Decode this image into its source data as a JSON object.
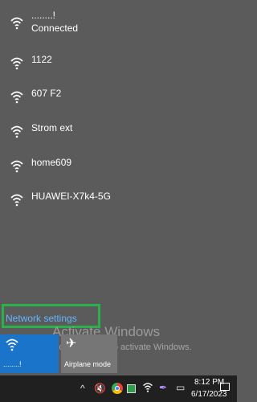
{
  "networks": [
    {
      "name": "........!",
      "status": "Connected",
      "icon": "wifi-icon"
    },
    {
      "name": "1122",
      "icon": "wifi-icon"
    },
    {
      "name": "607 F2",
      "icon": "wifi-icon"
    },
    {
      "name": "Strom ext",
      "icon": "wifi-icon"
    },
    {
      "name": "home609",
      "icon": "wifi-icon"
    },
    {
      "name": "HUAWEI-X7k4-5G",
      "icon": "wifi-icon"
    }
  ],
  "network_settings_label": "Network settings",
  "watermark": {
    "title": "Activate Windows",
    "subtitle": "Go to Settings to activate Windows."
  },
  "quick_actions": {
    "wifi_tile_label": "........!",
    "airplane_label": "Airplane mode"
  },
  "taskbar": {
    "time": "8:12 PM",
    "date": "6/17/2023"
  },
  "colors": {
    "panel_bg": "#5b5b5b",
    "accent_blue": "#1a74c9",
    "link_blue": "#64b5ff",
    "highlight_green": "#2bb14a",
    "taskbar_bg": "#202020"
  }
}
